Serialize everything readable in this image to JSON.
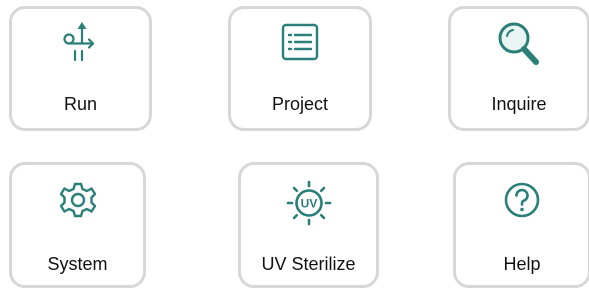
{
  "tiles": [
    {
      "id": "run",
      "label": "Run",
      "icon": "run-route-icon"
    },
    {
      "id": "project",
      "label": "Project",
      "icon": "list-document-icon"
    },
    {
      "id": "inquire",
      "label": "Inquire",
      "icon": "magnifier-icon"
    },
    {
      "id": "system",
      "label": "System",
      "icon": "gear-icon"
    },
    {
      "id": "uv",
      "label": "UV Sterilize",
      "icon": "uv-sun-icon"
    },
    {
      "id": "help",
      "label": "Help",
      "icon": "question-mark-icon"
    }
  ],
  "colors": {
    "accent": "#2a7f78",
    "tile_border": "#d7d7d7",
    "text": "#111111"
  }
}
